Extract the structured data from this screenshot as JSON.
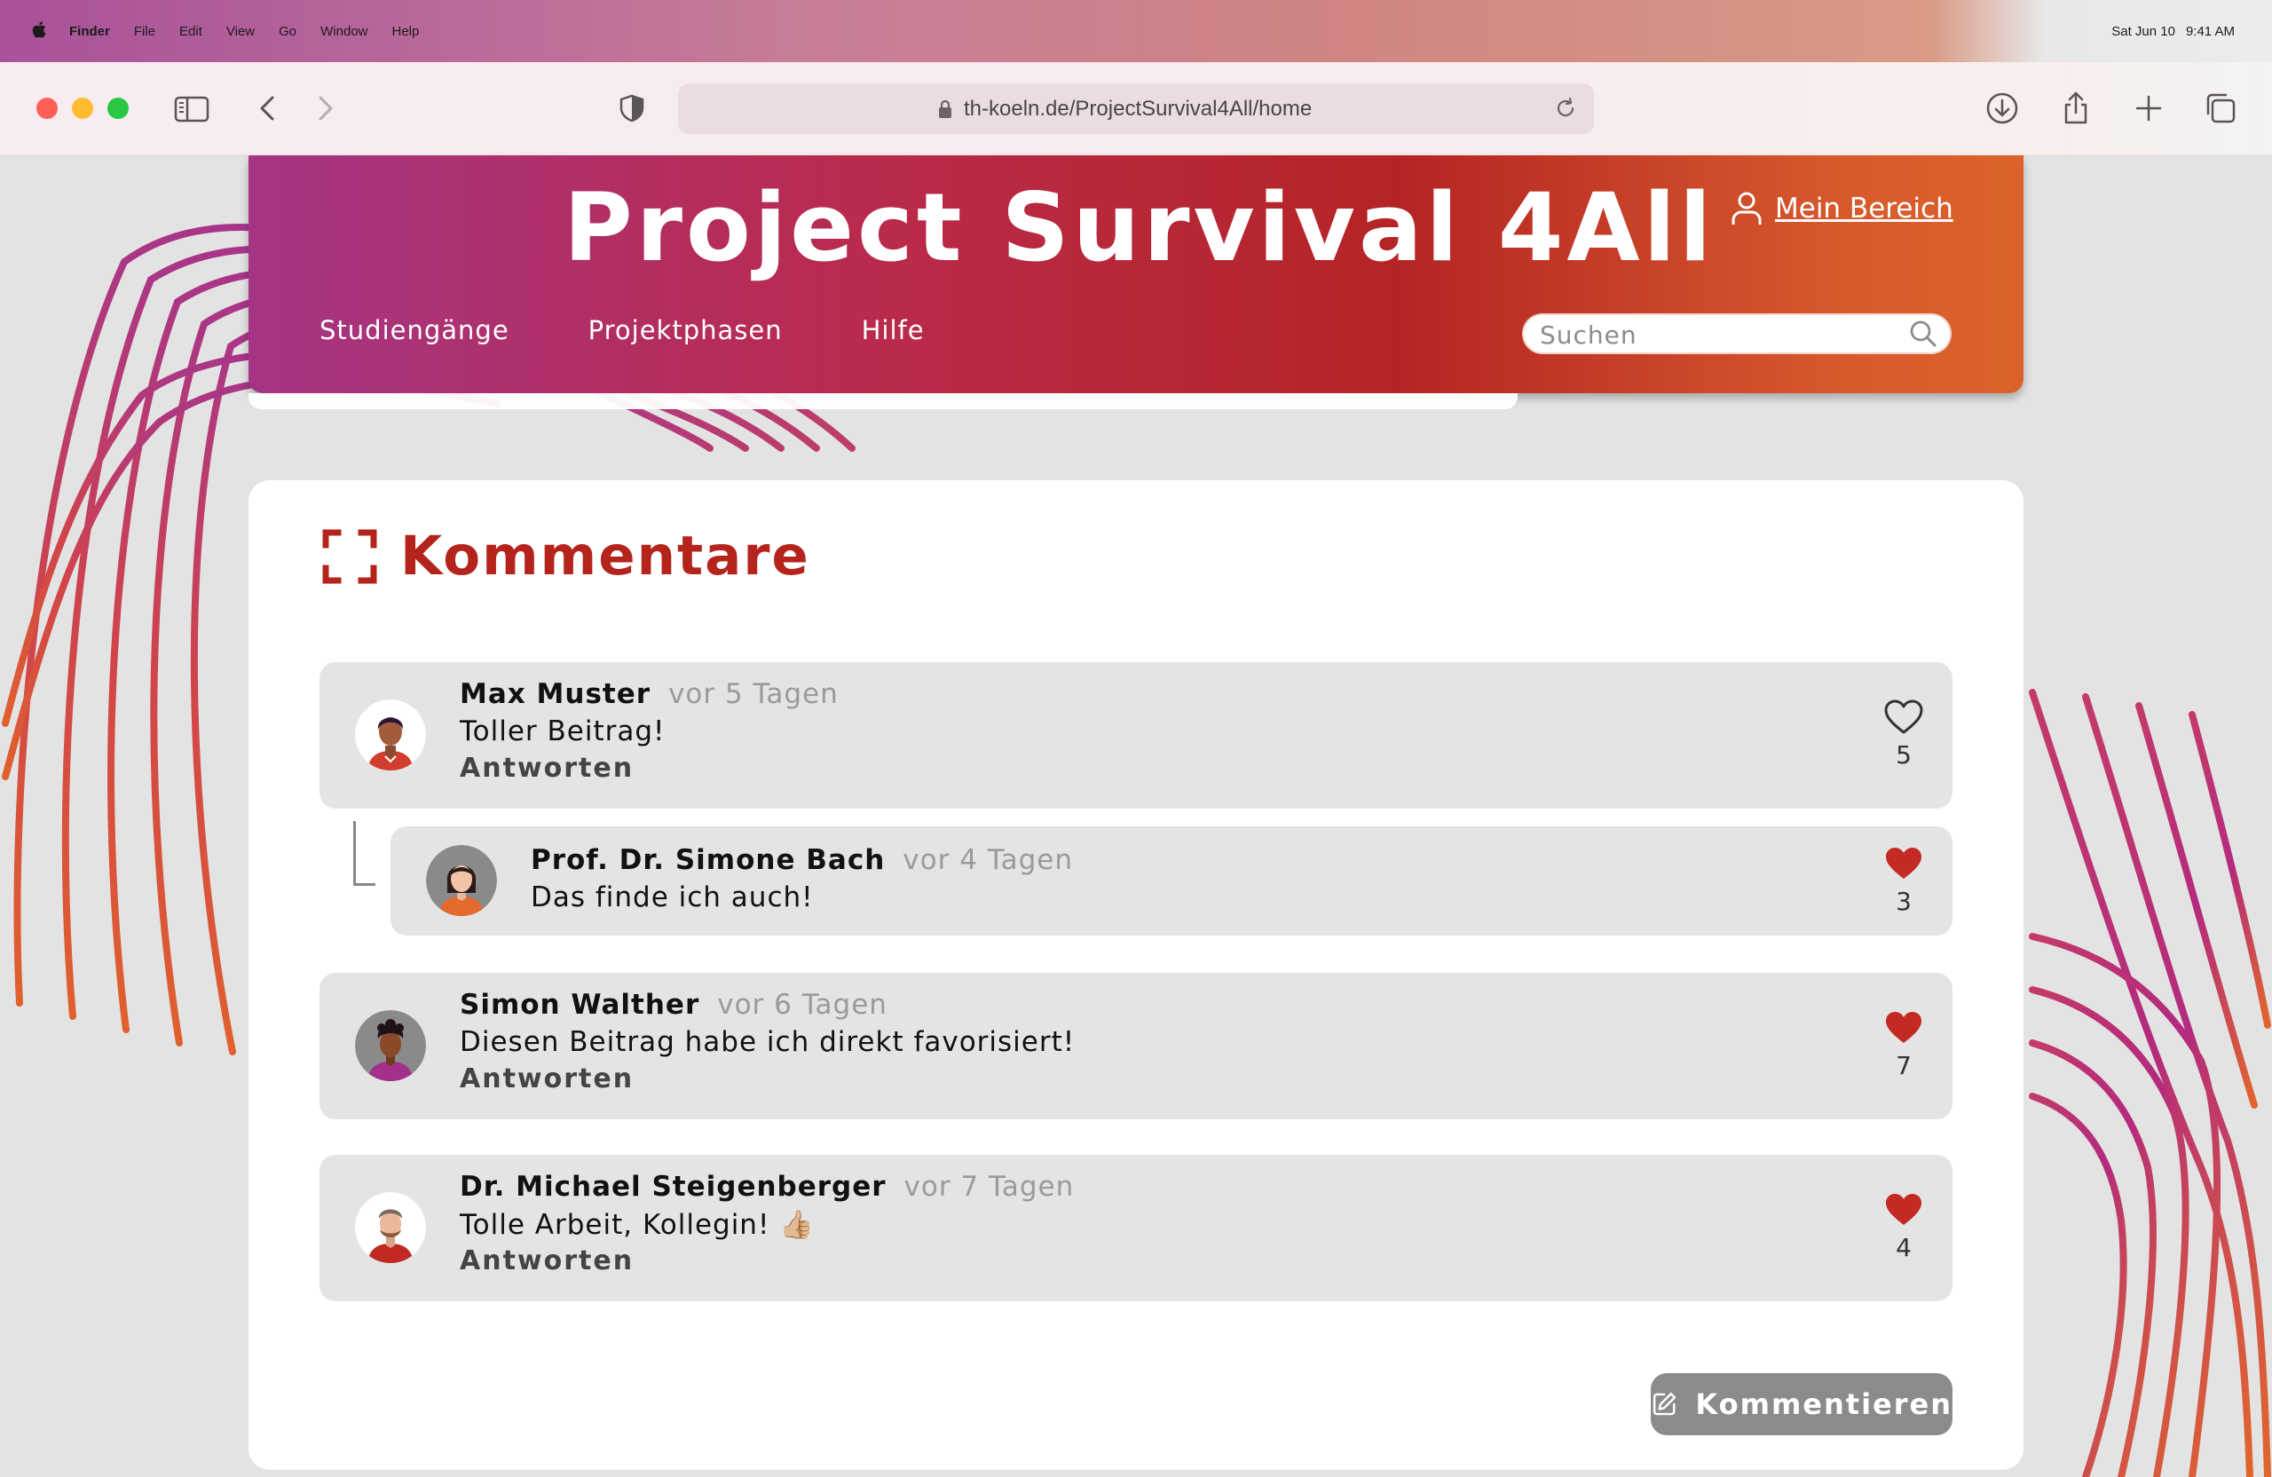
{
  "menubar": {
    "items": [
      "Finder",
      "File",
      "Edit",
      "View",
      "Go",
      "Window",
      "Help"
    ],
    "date": "Sat Jun 10",
    "time": "9:41 AM"
  },
  "browser": {
    "url": "th-koeln.de/ProjectSurvival4All/home"
  },
  "site": {
    "title": "Project Survival 4All",
    "account_label": "Mein Bereich",
    "nav": [
      "Studiengänge",
      "Projektphasen",
      "Hilfe"
    ],
    "search_placeholder": "Suchen"
  },
  "comments_section": {
    "title": "Kommentare",
    "reply_label": "Antworten",
    "comment_button": "Kommentieren",
    "comments": [
      {
        "name": "Max Muster",
        "time": "vor 5 Tagen",
        "text": "Toller Beitrag!",
        "likes": "5",
        "liked": false
      },
      {
        "name": "Prof. Dr. Simone Bach",
        "time": "vor 4 Tagen",
        "text": "Das finde ich auch!",
        "likes": "3",
        "liked": true,
        "is_reply": true
      },
      {
        "name": "Simon Walther",
        "time": "vor 6 Tagen",
        "text": "Diesen Beitrag habe ich direkt favorisiert!",
        "likes": "7",
        "liked": true
      },
      {
        "name": "Dr. Michael Steigenberger",
        "time": "vor 7 Tagen",
        "text": "Tolle Arbeit, Kollegin! 👍🏼",
        "likes": "4",
        "liked": true
      }
    ]
  },
  "colors": {
    "brand_red": "#b5241c",
    "brand_magenta": "#a53584",
    "brand_orange": "#db632b",
    "heart_filled": "#c42a24"
  }
}
